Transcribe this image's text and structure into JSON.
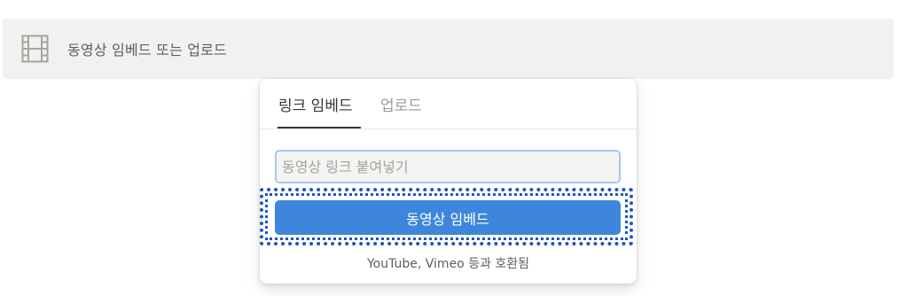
{
  "video_block": {
    "icon": "film-icon",
    "label": "동영상 임베드 또는 업로드"
  },
  "popup": {
    "tabs": [
      {
        "label": "링크 임베드",
        "active": true
      },
      {
        "label": "업로드",
        "active": false
      }
    ],
    "url_input": {
      "value": "",
      "placeholder": "동영상 링크 붙여넣기"
    },
    "embed_button_label": "동영상 임베드",
    "compat_note": "YouTube, Vimeo 등과 호환됨"
  },
  "colors": {
    "block_bg": "#f1f1ef",
    "button_bg": "#3e86db",
    "input_focus_border": "#a7c6ee",
    "highlight": "#1f54c4"
  }
}
